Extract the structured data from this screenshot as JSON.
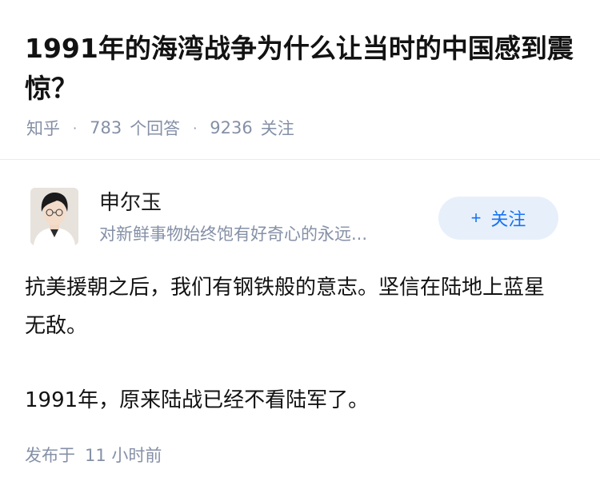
{
  "question": {
    "title": "1991年的海湾战争为什么让当时的中国感到震惊？",
    "source": "知乎",
    "separator": "·",
    "answer_count": "783",
    "answer_label": "个回答",
    "follower_count": "9236",
    "follower_label": "关注"
  },
  "author": {
    "avatar_icon": "avatar-portrait-icon",
    "name": "申尔玉",
    "bio": "对新鲜事物始终饱有好奇心的永远...",
    "follow_plus": "+",
    "follow_label": "关注"
  },
  "answer": {
    "paragraphs": [
      "抗美援朝之后，我们有钢铁般的意志。坚信在陆地上蓝星无敌。",
      "1991年，原来陆战已经不看陆军了。"
    ],
    "published_label": "发布于",
    "published_time": "11 小时前"
  },
  "colors": {
    "accent": "#1772f6",
    "follow_bg": "#e7f0fa",
    "meta_text": "#8590a6",
    "title_text": "#121212"
  }
}
